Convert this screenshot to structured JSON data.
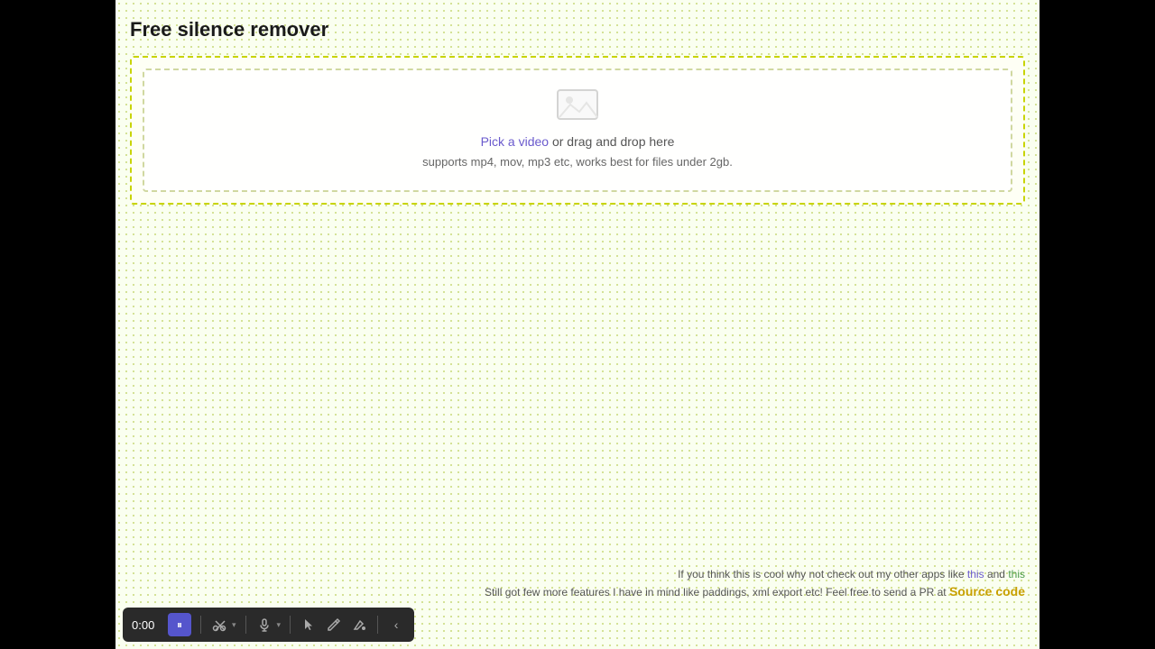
{
  "page": {
    "title": "Free silence remover"
  },
  "dropzone": {
    "link_text": "Pick a video",
    "text": " or drag and drop here",
    "subtext": "supports mp4, mov, mp3 etc, works best for files under 2gb."
  },
  "info": {
    "line1_prefix": "If you think this is cool why not check out my other apps like ",
    "link1_text": "this",
    "link1_middle": " and ",
    "link2_text": "this",
    "line2_prefix": "Still got few more features I have in mind like paddings, xml export etc! Feel free to send a PR at ",
    "source_link_text": "Source code"
  },
  "toolbar": {
    "time": "0:00",
    "pause_label": "⏸",
    "icons": [
      "✂",
      "🎙",
      "▶",
      "✏",
      "🪣",
      "‹"
    ]
  }
}
